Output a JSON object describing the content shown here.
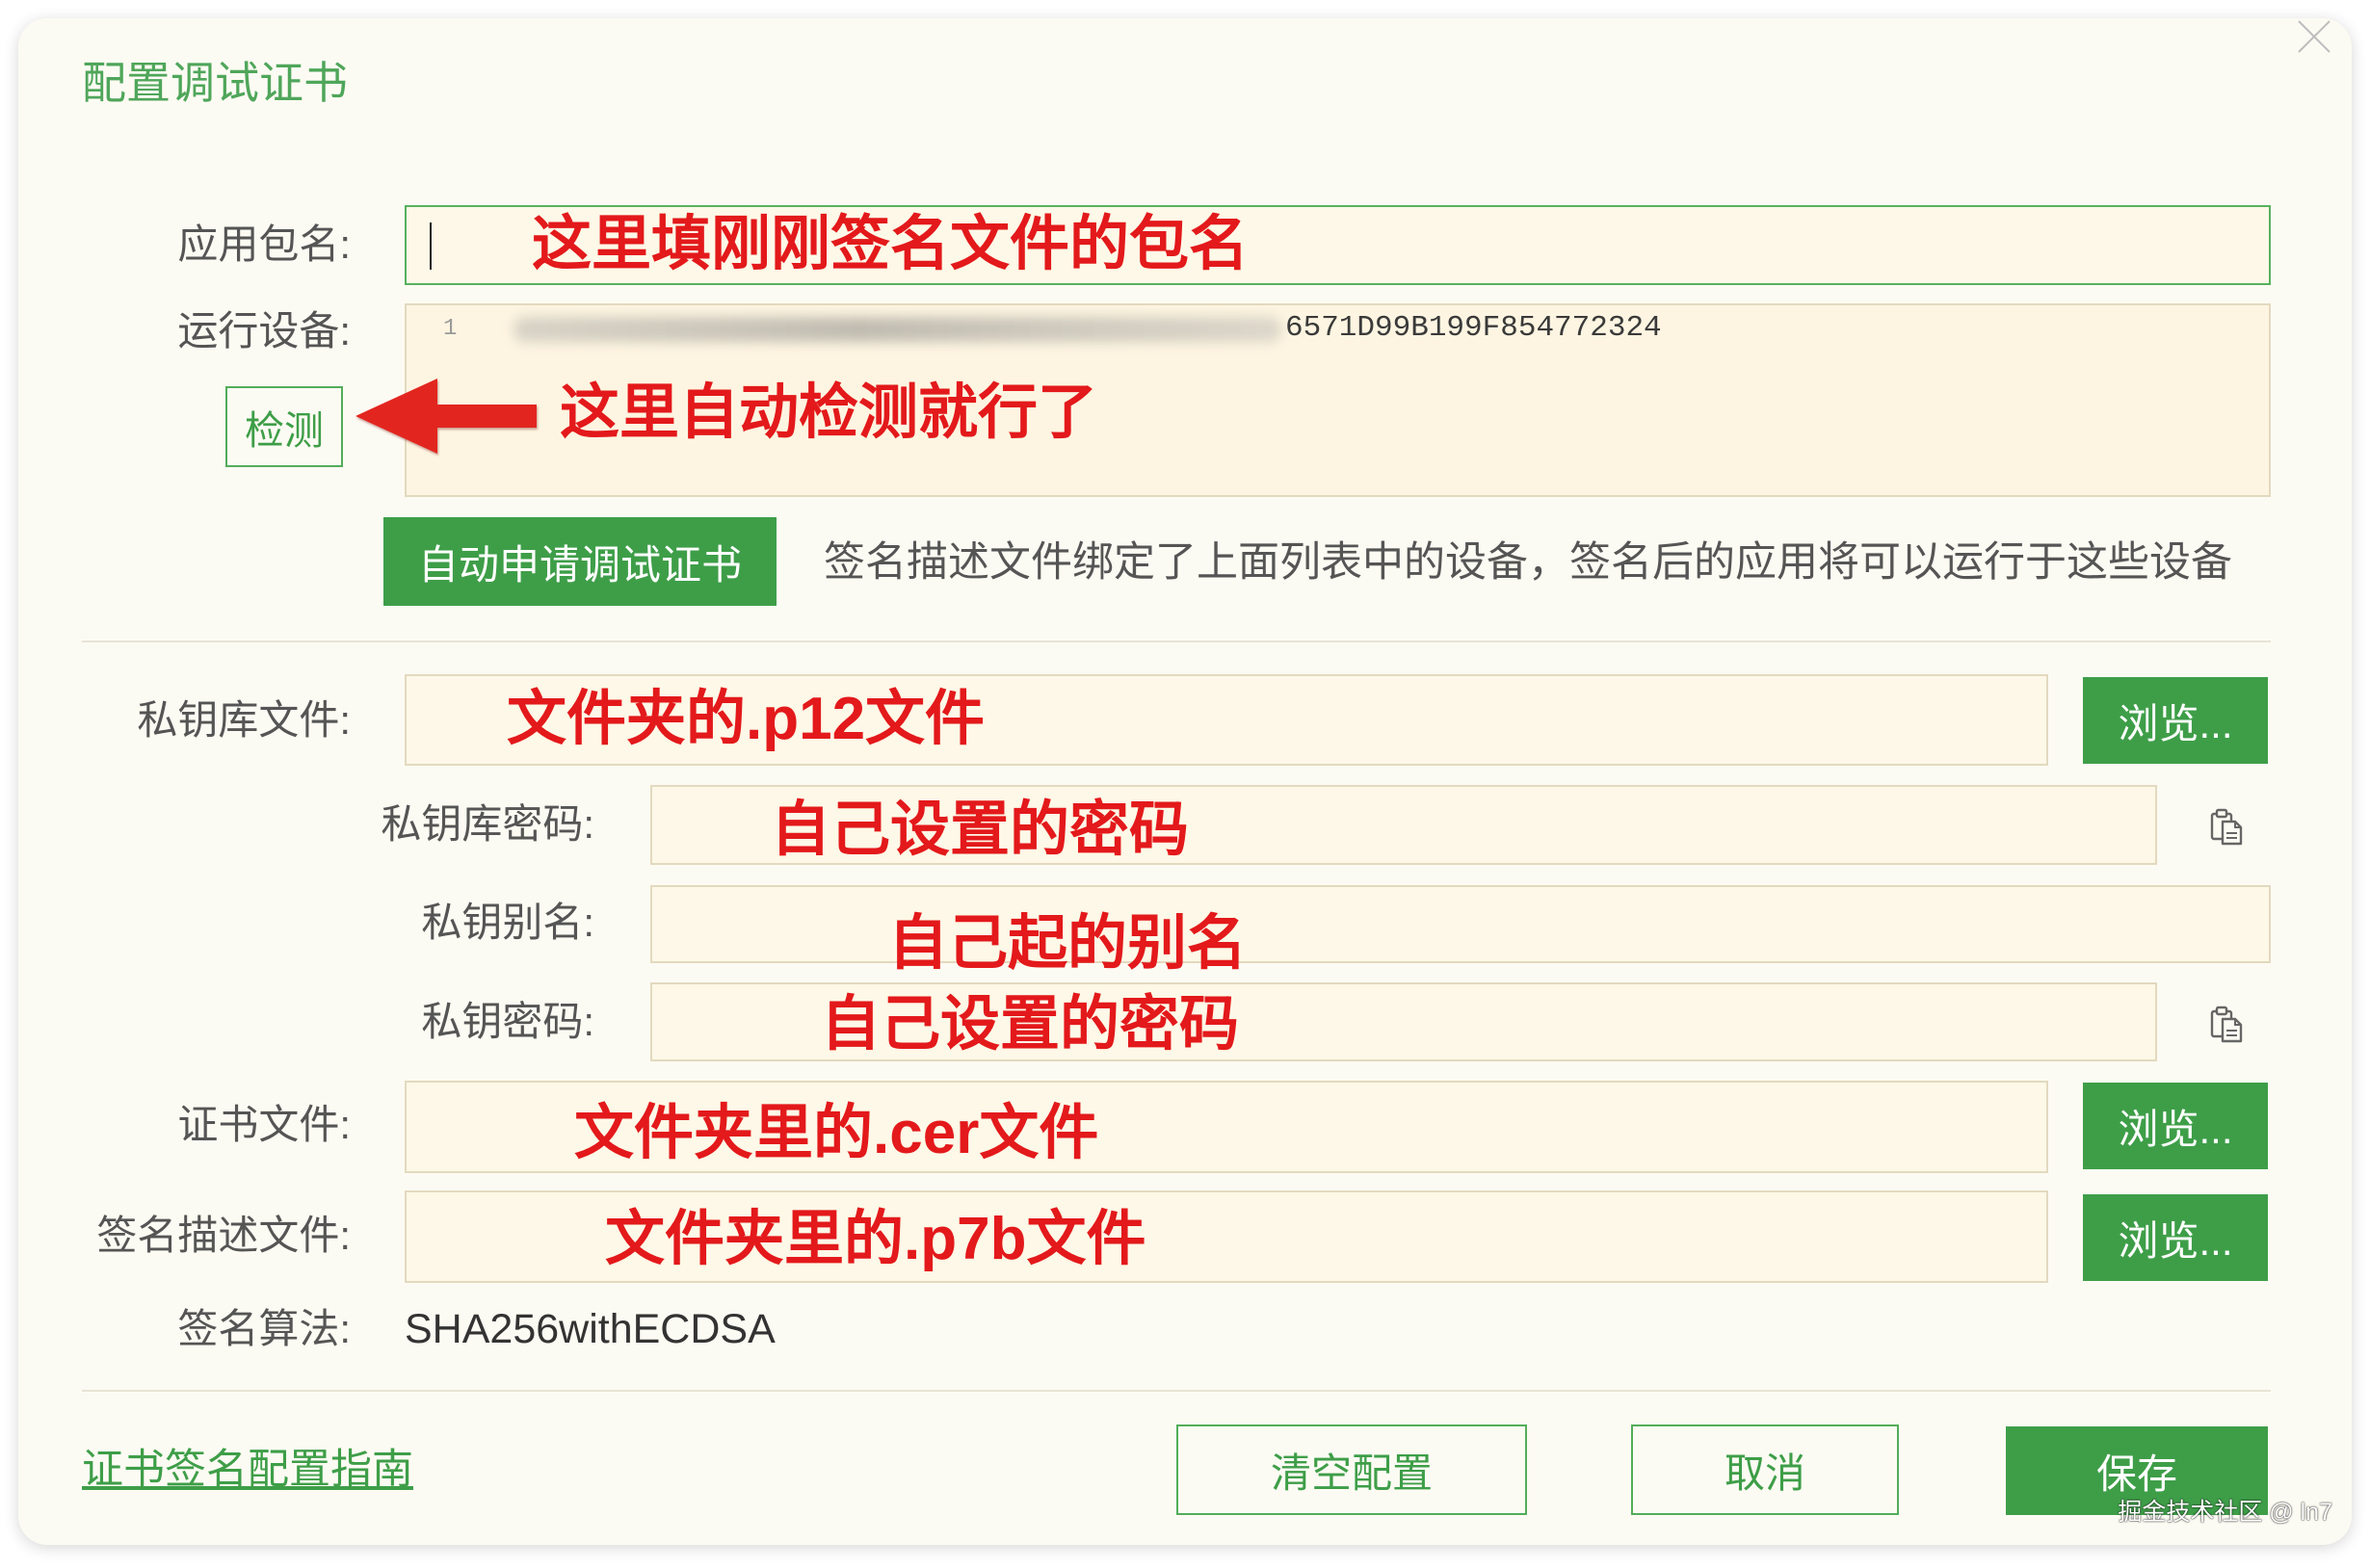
{
  "dialog": {
    "title": "配置调试证书",
    "close_icon": "close-icon"
  },
  "package_name": {
    "label": "应用包名:",
    "annotation": "这里填刚刚签名文件的包名"
  },
  "devices": {
    "label": "运行设备:",
    "line_number": "1",
    "device_id_visible": "6571D99B199F854772324",
    "detect_button": "检测",
    "annotation": "这里自动检测就行了",
    "arrow_icon": "left-arrow-icon"
  },
  "auto_apply": {
    "button": "自动申请调试证书",
    "hint": "签名描述文件绑定了上面列表中的设备，签名后的应用将可以运行于这些设备"
  },
  "keystore_file": {
    "label": "私钥库文件:",
    "annotation": "文件夹的.p12文件",
    "browse_button": "浏览..."
  },
  "keystore_password": {
    "label": "私钥库密码:",
    "annotation": "自己设置的密码",
    "paste_icon": "paste-icon"
  },
  "key_alias": {
    "label": "私钥别名:",
    "annotation": "自己起的别名"
  },
  "key_password": {
    "label": "私钥密码:",
    "annotation": "自己设置的密码",
    "paste_icon": "paste-icon"
  },
  "cert_file": {
    "label": "证书文件:",
    "annotation": "文件夹里的.cer文件",
    "browse_button": "浏览..."
  },
  "profile_file": {
    "label": "签名描述文件:",
    "annotation": "文件夹里的.p7b文件",
    "browse_button": "浏览..."
  },
  "sign_algorithm": {
    "label": "签名算法:",
    "value": "SHA256withECDSA"
  },
  "footer": {
    "guide_link": "证书签名配置指南",
    "clear_button": "清空配置",
    "cancel_button": "取消",
    "save_button": "保存"
  },
  "watermark": "掘金技术社区 @ ln7",
  "colors": {
    "accent": "#3e9e48",
    "title": "#4fa65a",
    "annotation": "#e3191b",
    "label_text": "#555555",
    "dialog_background": "#fcfbf3",
    "field_background": "#fdf8e7",
    "field_border": "#e3d9bf"
  }
}
